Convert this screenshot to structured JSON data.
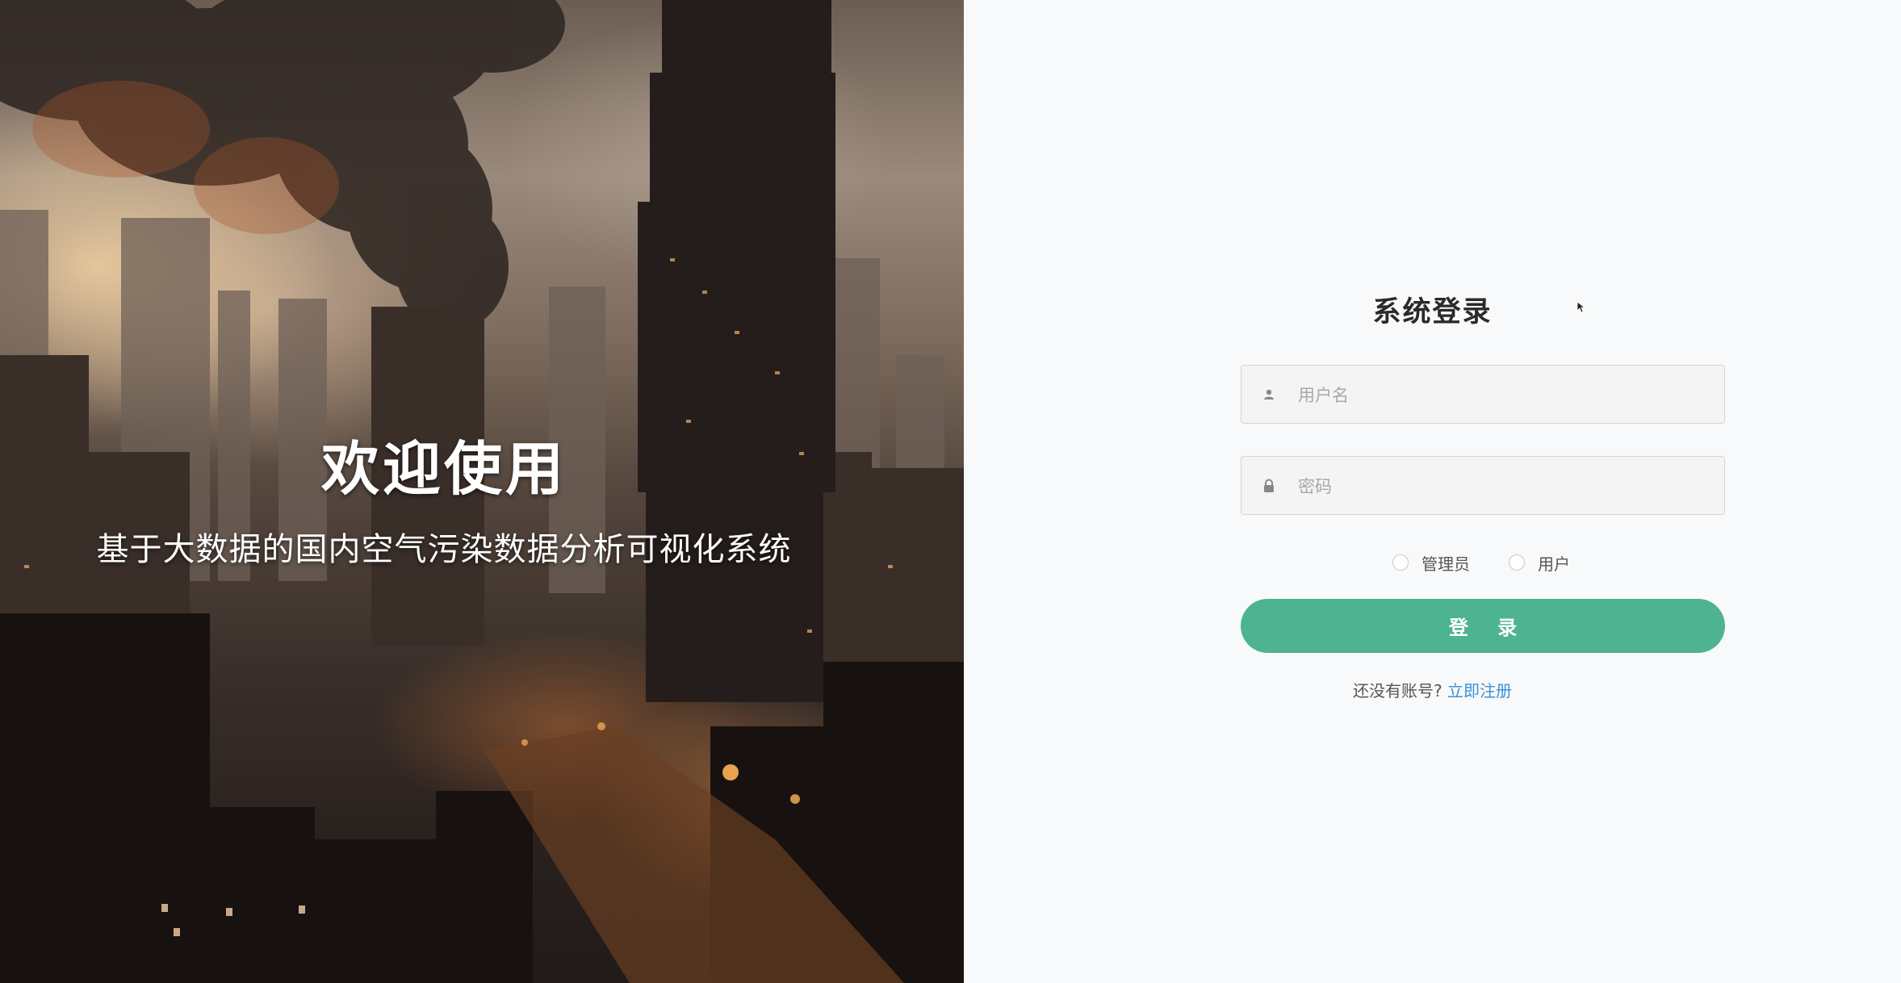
{
  "hero": {
    "title": "欢迎使用",
    "subtitle": "基于大数据的国内空气污染数据分析可视化系统"
  },
  "login": {
    "title": "系统登录",
    "username": {
      "placeholder": "用户名",
      "value": "",
      "icon": "user-icon"
    },
    "password": {
      "placeholder": "密码",
      "value": "",
      "icon": "lock-icon"
    },
    "roles": [
      {
        "label": "管理员",
        "selected": false
      },
      {
        "label": "用户",
        "selected": false
      }
    ],
    "submit_label": "登 录",
    "register_prompt": "还没有账号?",
    "register_link": "立即注册"
  },
  "colors": {
    "accent": "#4db391",
    "link": "#3d8fd6",
    "panel_bg": "#f8f9fa"
  }
}
